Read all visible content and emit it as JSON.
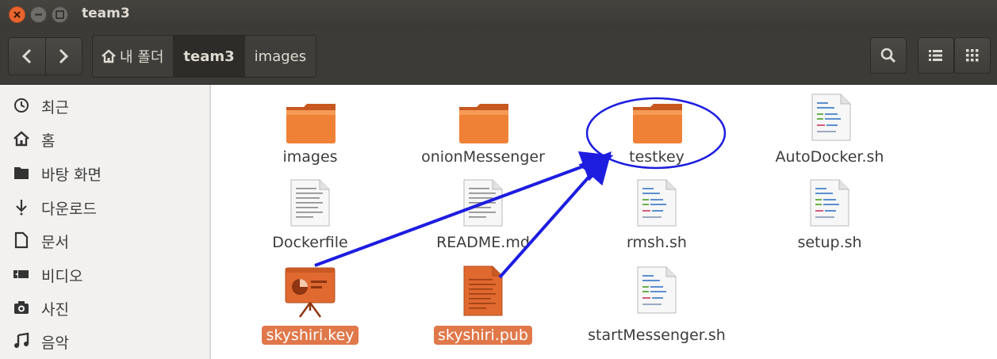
{
  "window": {
    "title": "team3"
  },
  "toolbar": {
    "back_icon": "chevron-left-icon",
    "forward_icon": "chevron-right-icon",
    "breadcrumb": [
      {
        "label": "내 폴더",
        "icon": "home-icon"
      },
      {
        "label": "team3"
      },
      {
        "label": "images"
      }
    ],
    "search_icon": "search-icon",
    "list_view_icon": "list-view-icon",
    "grid_view_icon": "grid-view-icon"
  },
  "sidebar": {
    "items": [
      {
        "label": "최근",
        "icon": "clock-icon"
      },
      {
        "label": "홈",
        "icon": "home-icon"
      },
      {
        "label": "바탕 화면",
        "icon": "folder-icon"
      },
      {
        "label": "다운로드",
        "icon": "download-icon"
      },
      {
        "label": "문서",
        "icon": "document-icon"
      },
      {
        "label": "비디오",
        "icon": "video-icon"
      },
      {
        "label": "사진",
        "icon": "camera-icon"
      },
      {
        "label": "음악",
        "icon": "music-icon"
      }
    ]
  },
  "files": [
    {
      "name": "images",
      "type": "folder"
    },
    {
      "name": "onionMessenger",
      "type": "folder"
    },
    {
      "name": "testkey",
      "type": "folder"
    },
    {
      "name": "AutoDocker.sh",
      "type": "script"
    },
    {
      "name": "Dockerfile",
      "type": "text"
    },
    {
      "name": "README.md",
      "type": "text"
    },
    {
      "name": "rmsh.sh",
      "type": "script"
    },
    {
      "name": "setup.sh",
      "type": "script"
    },
    {
      "name": "skyshiri.key",
      "type": "presentation",
      "selected": true
    },
    {
      "name": "skyshiri.pub",
      "type": "orange-doc",
      "selected": true
    },
    {
      "name": "startMessenger.sh",
      "type": "script"
    }
  ],
  "colors": {
    "accent": "#e0784a",
    "annotation": "#1d1de0",
    "titlebar": "#3c3b37"
  }
}
